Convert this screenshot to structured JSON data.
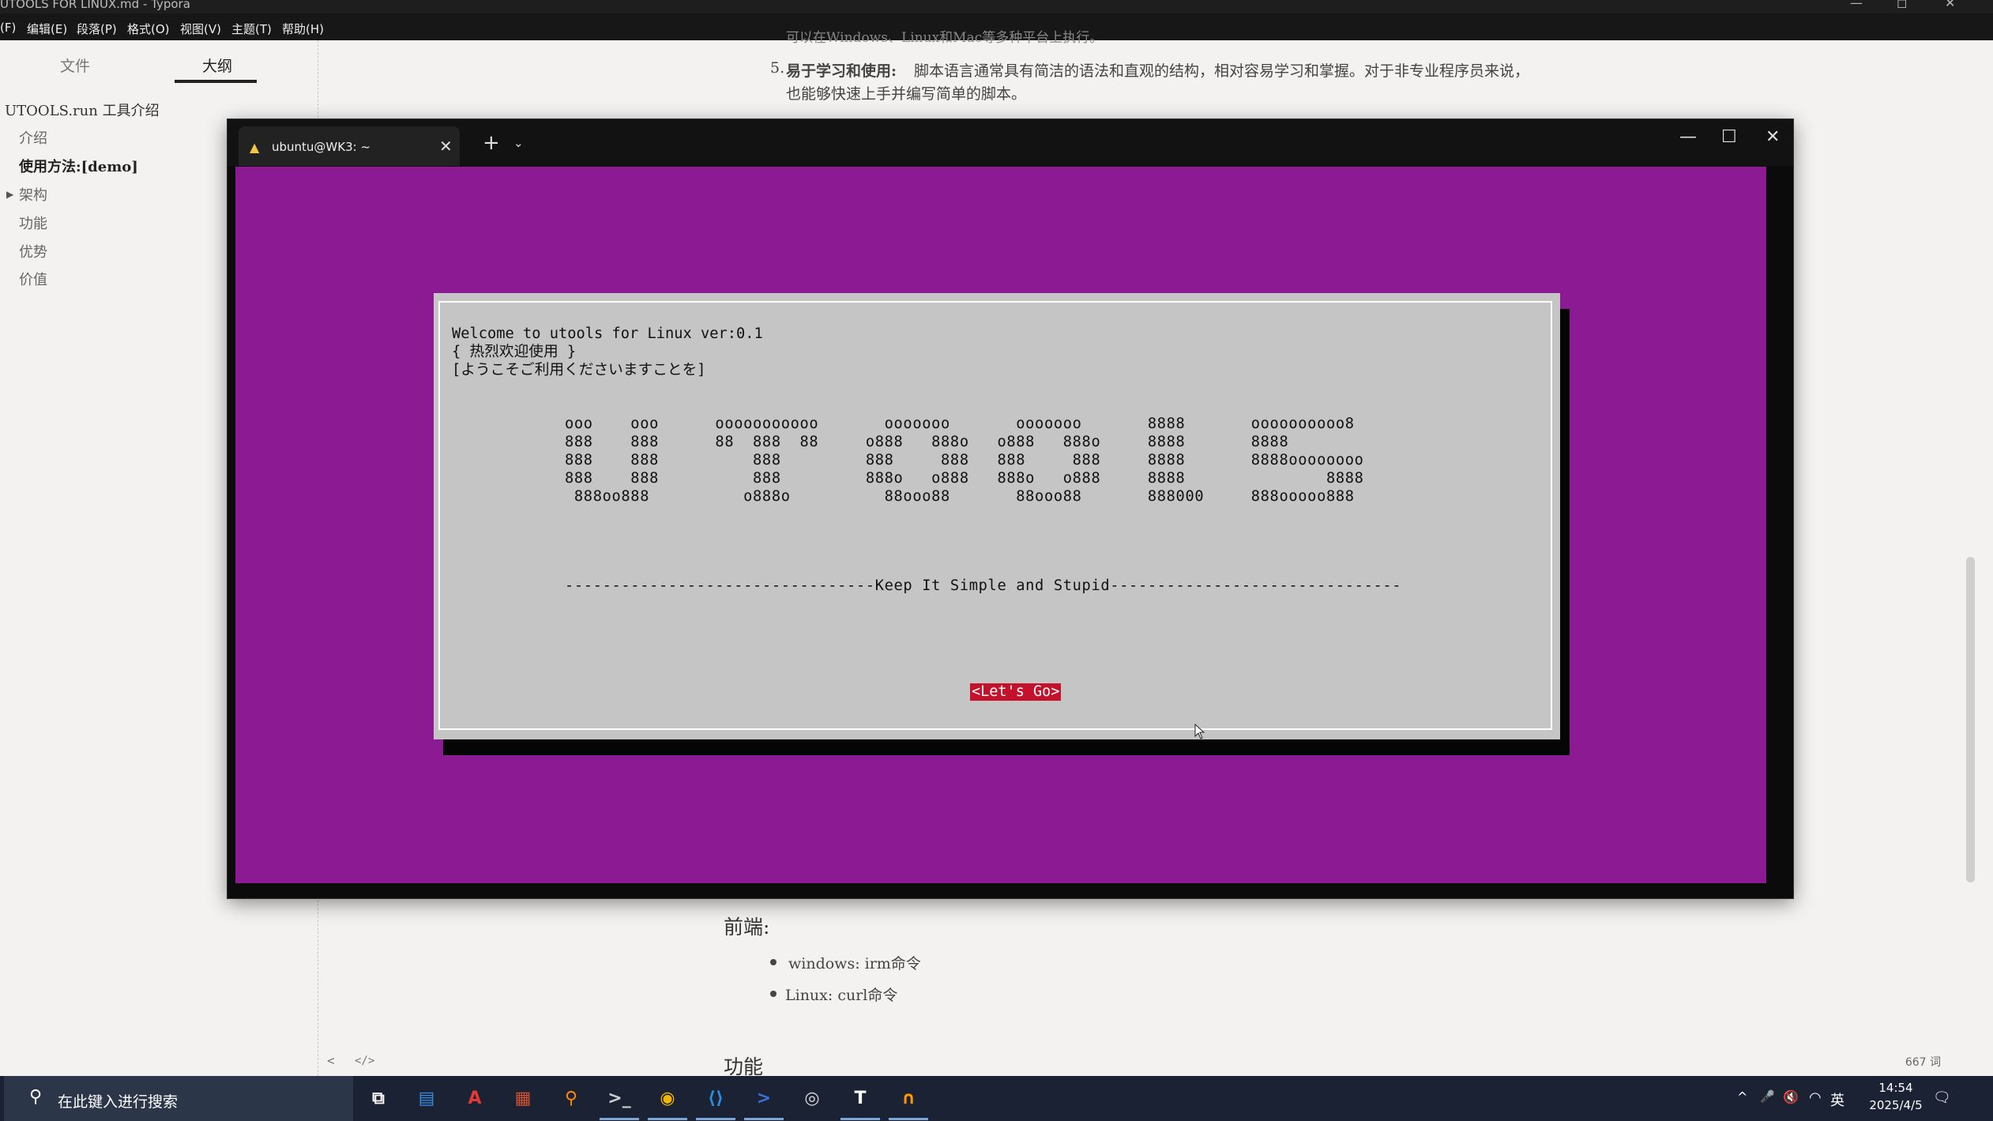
{
  "window": {
    "title": "UTOOLS FOR LINUX.md - Typora",
    "controls": {
      "minimize": "—",
      "maximize": "◻",
      "close": "✕"
    }
  },
  "menubar": [
    "(F)",
    "编辑(E)",
    "段落(P)",
    "格式(O)",
    "视图(V)",
    "主题(T)",
    "帮助(H)"
  ],
  "sidebar": {
    "tabs": [
      {
        "label": "文件"
      },
      {
        "label": "大纲"
      }
    ],
    "active_tab": "大纲",
    "outline": [
      {
        "label": "UTOOLS.run 工具介绍",
        "level": 1
      },
      {
        "label": "介绍",
        "level": 2
      },
      {
        "label": "使用方法:[demo]",
        "level": 2,
        "active": true
      },
      {
        "label": "架构",
        "level": 2,
        "collapsed": true
      },
      {
        "label": "功能",
        "level": 2
      },
      {
        "label": "优势",
        "level": 2
      },
      {
        "label": "价值",
        "level": 2
      }
    ]
  },
  "editor": {
    "partial_top": "可以在Windows、Linux和Mac等多种平台上执行。",
    "item5_number": "5.",
    "item5_bold": "易于学习和使用:",
    "item5_text": "脚本语言通常具有简洁的语法和直观的结构，相对容易学习和掌握。对于非专业程序员来说，",
    "item5_text2": "也能够快速上手并编写简单的脚本。",
    "frontend_heading": "前端:",
    "bullets": [
      "windows: irm命令",
      "Linux: curl命令"
    ],
    "section_heading": "功能",
    "word_count": "667 词",
    "footer_left": "<",
    "footer_code": "</>"
  },
  "terminal": {
    "tab_title": "ubuntu@WK3: ~",
    "tab_close": "✕",
    "new_tab": "+",
    "dropdown": "⌄",
    "controls": {
      "minimize": "—",
      "maximize": "☐",
      "close": "✕"
    },
    "colors": {
      "background": "#8b1a93",
      "dialog": "#c5c5c5",
      "button": "#c4122d"
    },
    "dialog": {
      "lines": [
        "Welcome to utools for Linux ver:0.1",
        "{ 热烈欢迎使用 }",
        "[ようこそご利用くださいますことを]"
      ],
      "ascii_art": [
        "ooo    ooo      ooooooooooo       ooooooo       ooooooo       8888       oooooooooo8",
        "888    888      88  888  88     o888   888o   o888   888o     8888       8888",
        "888    888          888         888     888   888     888     8888       8888oooooooo",
        "888    888          888         888o   o888   888o   o888     8888               8888",
        " 888oo888          o888o          88ooo88       88ooo88       888000     888ooooo888"
      ],
      "motto": "---------------------------------Keep It Simple and Stupid-------------------------------",
      "button": "<Let's Go>"
    }
  },
  "taskbar": {
    "search_placeholder": "在此键入进行搜索",
    "apps": [
      {
        "name": "task-view",
        "glyph": "⧉",
        "color": "#ffffff"
      },
      {
        "name": "app-blue",
        "glyph": "▤",
        "color": "#3a8ee6"
      },
      {
        "name": "acrobat",
        "glyph": "A",
        "color": "#e53935"
      },
      {
        "name": "office",
        "glyph": "▦",
        "color": "#d35230"
      },
      {
        "name": "search-app",
        "glyph": "⚲",
        "color": "#ff8a00"
      },
      {
        "name": "terminal",
        "glyph": ">_",
        "color": "#d0d0d0",
        "active": true
      },
      {
        "name": "chrome",
        "glyph": "◉",
        "color": "#f2b705",
        "active": true
      },
      {
        "name": "vscode",
        "glyph": "⟨⟩",
        "color": "#2a8de0",
        "active": true
      },
      {
        "name": "powershell",
        "glyph": ">",
        "color": "#3d6fd6",
        "active": true
      },
      {
        "name": "circle-app",
        "glyph": "◎",
        "color": "#dddddd"
      },
      {
        "name": "typora",
        "glyph": "T",
        "color": "#ffffff",
        "active": true
      },
      {
        "name": "orange-app",
        "glyph": "∩",
        "color": "#ff9800",
        "active": true
      }
    ],
    "tray": {
      "chevron": "^",
      "mic": "🎤",
      "volume": "🔇",
      "wifi": "◠",
      "ime": "英"
    },
    "time": "14:54",
    "date": "2025/4/5",
    "notification": "🗨"
  }
}
